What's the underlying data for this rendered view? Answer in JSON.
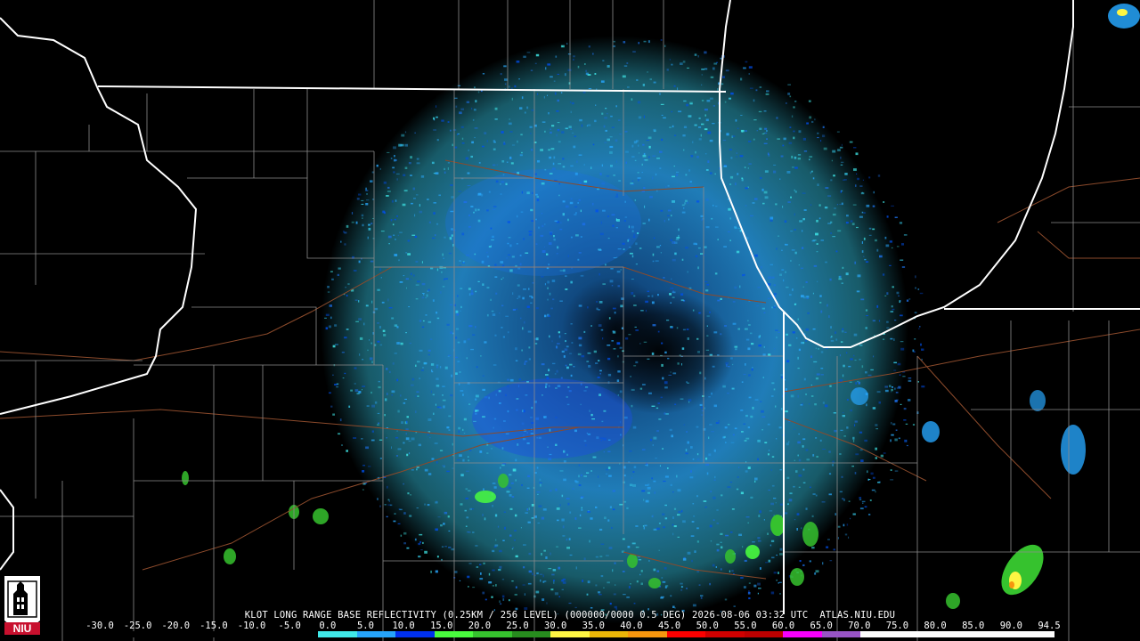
{
  "product_caption": "KLOT LONG RANGE BASE REFLECTIVITY (0.25KM / 256 LEVEL) (000000/0000 0.5 DEG) 2026-08-06 03:32 UTC  ATLAS.NIU.EDU",
  "logo": {
    "text": "NIU",
    "color": "#c8102e"
  },
  "colors": {
    "background": "#000000",
    "state_border": "#ffffff",
    "county_border": "#8c8c8c",
    "road": "#8b4a2b"
  },
  "scale": {
    "ticks": [
      "-30.0",
      "-25.0",
      "-20.0",
      "-15.0",
      "-10.0",
      "-5.0",
      "0.0",
      "5.0",
      "10.0",
      "15.0",
      "20.0",
      "25.0",
      "30.0",
      "35.0",
      "40.0",
      "45.0",
      "50.0",
      "55.0",
      "60.0",
      "65.0",
      "70.0",
      "75.0",
      "80.0",
      "85.0",
      "90.0",
      "94.5"
    ],
    "colors": [
      "#000000",
      "#000000",
      "#000000",
      "#000000",
      "#000000",
      "#000000",
      "#40e8e8",
      "#26a4fa",
      "#0030ed",
      "#49fb3e",
      "#36c22e",
      "#278c1e",
      "#fef543",
      "#ebb608",
      "#f6960e",
      "#fd0000",
      "#d00000",
      "#bd0000",
      "#f800fd",
      "#9854c6",
      "#fdfdfd",
      "#fdfdfd",
      "#fdfdfd",
      "#fdfdfd",
      "#fdfdfd"
    ]
  }
}
